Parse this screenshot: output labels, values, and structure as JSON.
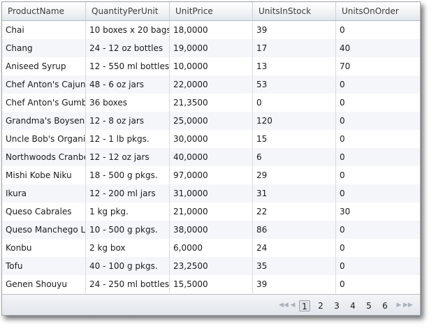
{
  "columns": [
    "ProductName",
    "QuantityPerUnit",
    "UnitPrice",
    "UnitsInStock",
    "UnitsOnOrder"
  ],
  "rows": [
    [
      "Chai",
      "10 boxes x 20 bags",
      "18,0000",
      "39",
      "0"
    ],
    [
      "Chang",
      "24 - 12 oz bottles",
      "19,0000",
      "17",
      "40"
    ],
    [
      "Aniseed Syrup",
      "12 - 550 ml bottles",
      "10,0000",
      "13",
      "70"
    ],
    [
      "Chef Anton's Cajun",
      "48 - 6 oz jars",
      "22,0000",
      "53",
      "0"
    ],
    [
      "Chef Anton's Gumbo",
      "36 boxes",
      "21,3500",
      "0",
      "0"
    ],
    [
      "Grandma's Boysenb",
      "12 - 8 oz jars",
      "25,0000",
      "120",
      "0"
    ],
    [
      "Uncle Bob's Organic",
      "12 - 1 lb pkgs.",
      "30,0000",
      "15",
      "0"
    ],
    [
      "Northwoods Cranbe",
      "12 - 12 oz jars",
      "40,0000",
      "6",
      "0"
    ],
    [
      "Mishi Kobe Niku",
      "18 - 500 g pkgs.",
      "97,0000",
      "29",
      "0"
    ],
    [
      "Ikura",
      "12 - 200 ml jars",
      "31,0000",
      "31",
      "0"
    ],
    [
      "Queso Cabrales",
      "1 kg pkg.",
      "21,0000",
      "22",
      "30"
    ],
    [
      "Queso Manchego La",
      "10 - 500 g pkgs.",
      "38,0000",
      "86",
      "0"
    ],
    [
      "Konbu",
      "2 kg box",
      "6,0000",
      "24",
      "0"
    ],
    [
      "Tofu",
      "40 - 100 g pkgs.",
      "23,2500",
      "35",
      "0"
    ],
    [
      "Genen Shouyu",
      "24 - 250 ml bottles",
      "15,5000",
      "39",
      "0"
    ]
  ],
  "pager": {
    "pages": [
      "1",
      "2",
      "3",
      "4",
      "5",
      "6"
    ],
    "current": "1",
    "icons": [
      "first-page-icon",
      "previous-page-icon",
      "next-page-icon",
      "last-page-icon"
    ]
  }
}
